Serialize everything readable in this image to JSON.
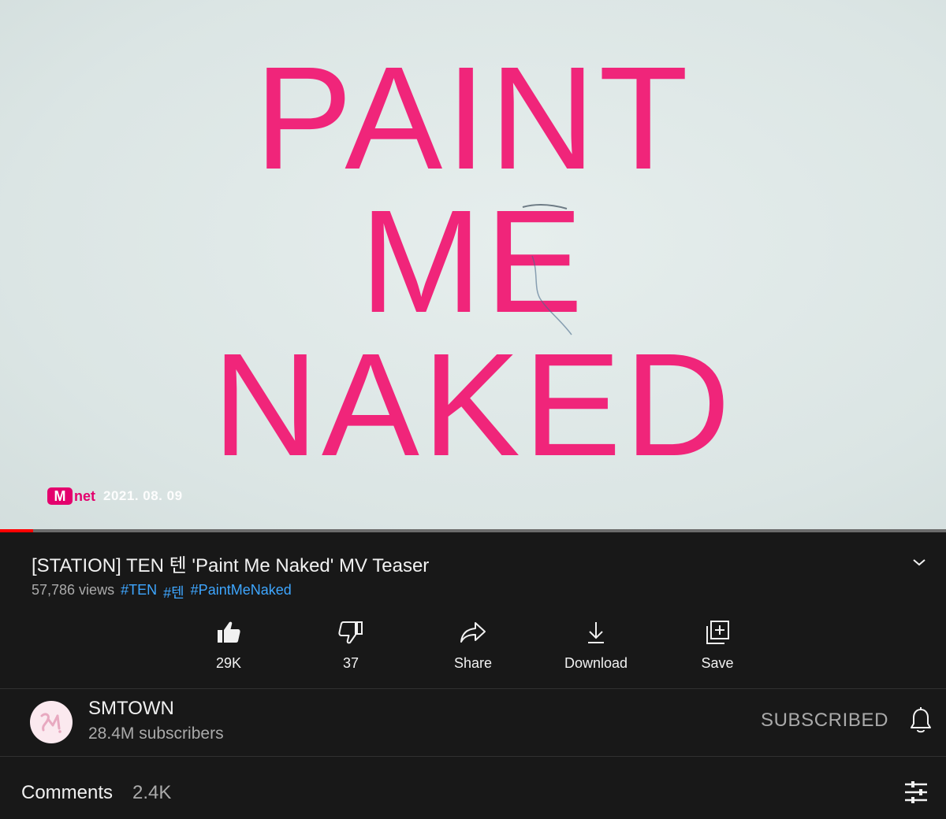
{
  "player": {
    "frame_text": [
      "PAINT",
      "ME",
      "NAKED"
    ],
    "watermark_logo": "net",
    "watermark_logo_m": "M",
    "watermark_date": "2021. 08. 09",
    "progress_fraction": 0.035,
    "frame_text_color": "#f0257a"
  },
  "video": {
    "title": "[STATION] TEN 텐 'Paint Me Naked' MV Teaser",
    "views": "57,786 views",
    "hashtags": [
      "#TEN",
      "#텐",
      "#PaintMeNaked"
    ]
  },
  "actions": [
    {
      "icon": "thumbs-up-icon",
      "label": "29K"
    },
    {
      "icon": "thumbs-down-icon",
      "label": "37"
    },
    {
      "icon": "share-icon",
      "label": "Share"
    },
    {
      "icon": "download-icon",
      "label": "Download"
    },
    {
      "icon": "save-playlist-icon",
      "label": "Save"
    }
  ],
  "channel": {
    "name": "SMTOWN",
    "subscribers": "28.4M subscribers",
    "subscribe_state": "SUBSCRIBED"
  },
  "comments": {
    "label": "Comments",
    "count": "2.4K"
  },
  "colors": {
    "background": "#181818",
    "accent_link": "#3ea6ff",
    "progress": "#ff0000",
    "brand_pink": "#f0257a"
  }
}
